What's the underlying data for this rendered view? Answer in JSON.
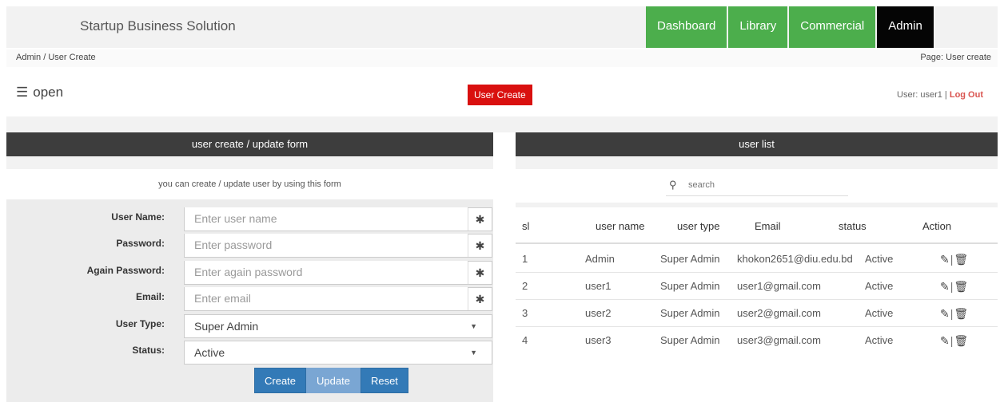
{
  "app": {
    "brand": "Startup Business Solution",
    "nav": [
      {
        "label": "Dashboard"
      },
      {
        "label": "Library"
      },
      {
        "label": "Commercial"
      },
      {
        "label": "Admin"
      }
    ]
  },
  "breadcrumb": "Admin / User Create",
  "page_label": "Page: User create",
  "menu_toggle": {
    "icon": "☰",
    "label": "open"
  },
  "user_create_button": "User Create",
  "user_info": {
    "prefix": "User: user1 | ",
    "logout": "Log Out"
  },
  "form_panel": {
    "title": "user create / update form",
    "description": "you can create / update user by using this form",
    "fields": [
      {
        "label": "User Name:",
        "placeholder": "Enter user name"
      },
      {
        "label": "Password:",
        "placeholder": "Enter password"
      },
      {
        "label": "Again Password:",
        "placeholder": "Enter again password"
      },
      {
        "label": "Email:",
        "placeholder": "Enter email"
      }
    ],
    "selects": [
      {
        "label": "User Type:",
        "value": "Super Admin"
      },
      {
        "label": "Status:",
        "value": "Active"
      }
    ],
    "required_mark": "✱",
    "caret": "▼",
    "buttons": {
      "create": "Create",
      "update": "Update",
      "reset": "Reset"
    }
  },
  "list_panel": {
    "title": "user list",
    "search_placeholder": "search",
    "search_icon": "⚲",
    "columns": [
      "sl",
      "user name",
      "user type",
      "Email",
      "status",
      "Action"
    ],
    "rows": [
      {
        "sl": "1",
        "name": "Admin",
        "type": "Super Admin",
        "email": "khokon2651@diu.edu.bd",
        "status": "Active"
      },
      {
        "sl": "2",
        "name": "user1",
        "type": "Super Admin",
        "email": "user1@gmail.com",
        "status": "Active"
      },
      {
        "sl": "3",
        "name": "user2",
        "type": "Super Admin",
        "email": "user2@gmail.com",
        "status": "Active"
      },
      {
        "sl": "4",
        "name": "user3",
        "type": "Super Admin",
        "email": "user3@gmail.com",
        "status": "Active"
      }
    ],
    "edit_icon": "✎",
    "delete_icon": "🗑",
    "action_sep": "|"
  },
  "colors": {
    "nav_green": "#4cae4c",
    "nav_black": "#050505",
    "danger": "#d9100f",
    "primary": "#337ab7",
    "panel_head": "#3d3d3d"
  }
}
